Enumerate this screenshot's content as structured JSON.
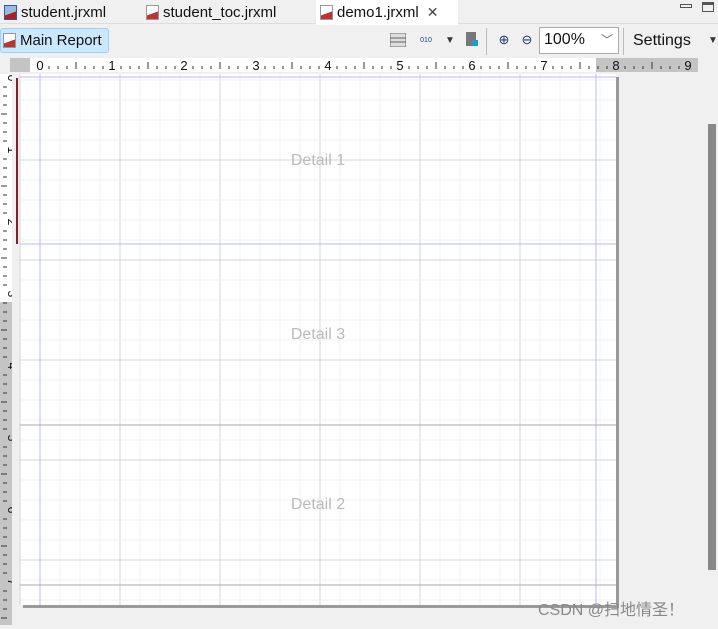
{
  "tabs": [
    {
      "label": "student.jrxml",
      "active": false
    },
    {
      "label": "student_toc.jrxml",
      "active": false
    },
    {
      "label": "demo1.jrxml",
      "active": true
    }
  ],
  "toolbar": {
    "main_report": "Main Report",
    "zoom_value": "100%",
    "settings": "Settings"
  },
  "ruler": {
    "horizontal": [
      "0",
      "1",
      "2",
      "3",
      "4",
      "5",
      "6",
      "7",
      "8",
      "9"
    ],
    "vertical": [
      "0",
      "1",
      "2",
      "3",
      "4",
      "5",
      "6",
      "7"
    ]
  },
  "bands": [
    {
      "label": "Detail 1"
    },
    {
      "label": "Detail 3"
    },
    {
      "label": "Detail 2"
    }
  ],
  "watermark": "CSDN @扫地情圣！",
  "colors": {
    "selection": "#cce8ff",
    "band_marker": "#8b1a2b",
    "margin_guide": "#b8b8ff"
  }
}
